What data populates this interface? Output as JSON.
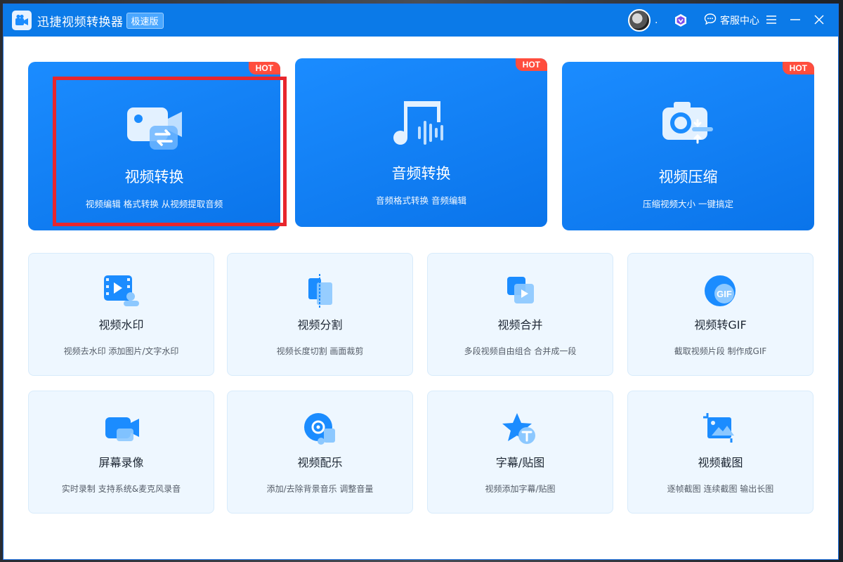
{
  "app": {
    "title": "迅捷视频转换器",
    "edition": "极速版",
    "username": ".",
    "service_label": "客服中心"
  },
  "hot_label": "HOT",
  "featured": [
    {
      "title": "视频转换",
      "desc": "视频编辑 格式转换 从视频提取音频",
      "icon": "video-convert-icon",
      "selected": true
    },
    {
      "title": "音频转换",
      "desc": "音频格式转换 音频编辑",
      "icon": "music-note-icon",
      "selected": false
    },
    {
      "title": "视频压缩",
      "desc": "压缩视频大小 一键搞定",
      "icon": "camera-compress-icon",
      "selected": false
    }
  ],
  "tools": [
    {
      "title": "视频水印",
      "desc": "视频去水印 添加图片/文字水印",
      "icon": "film-watermark-icon"
    },
    {
      "title": "视频分割",
      "desc": "视频长度切割 画面裁剪",
      "icon": "split-icon"
    },
    {
      "title": "视频合并",
      "desc": "多段视频自由组合 合并成一段",
      "icon": "merge-icon"
    },
    {
      "title": "视频转GIF",
      "desc": "截取视频片段 制作成GIF",
      "icon": "gif-icon"
    },
    {
      "title": "屏幕录像",
      "desc": "实时录制 支持系统&麦克风录音",
      "icon": "screen-record-icon"
    },
    {
      "title": "视频配乐",
      "desc": "添加/去除背景音乐 调整音量",
      "icon": "disc-music-icon"
    },
    {
      "title": "字幕/贴图",
      "desc": "视频添加字幕/贴图",
      "icon": "star-text-icon"
    },
    {
      "title": "视频截图",
      "desc": "逐帧截图 连续截图 输出长图",
      "icon": "screenshot-icon"
    }
  ],
  "colors": {
    "titlebar": "#0b7ae8",
    "featured_card": "#1b8cff",
    "hot_tag": "#ff4d3d",
    "selection_outline": "#e8262d",
    "tool_card": "#eef7ff"
  }
}
